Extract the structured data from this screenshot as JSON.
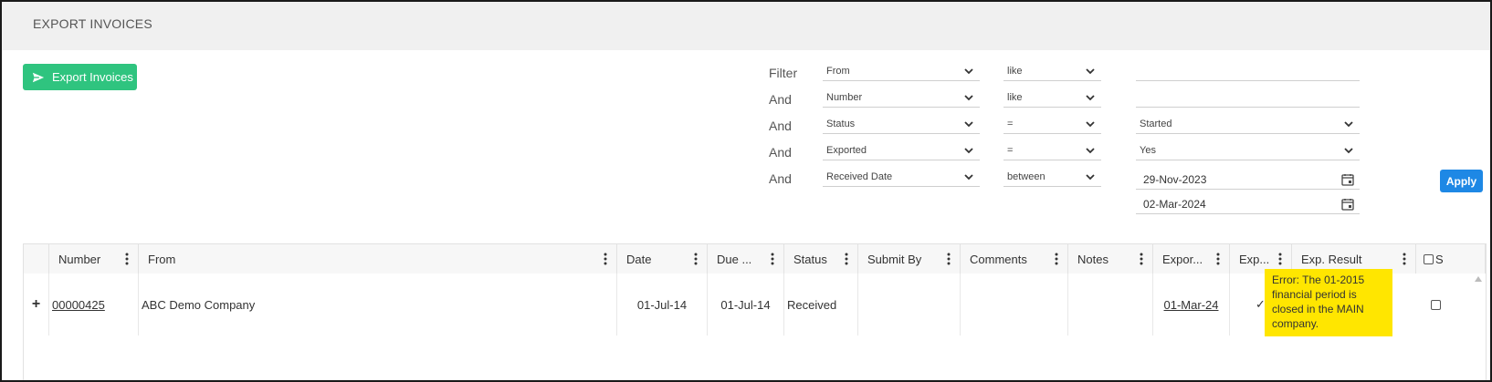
{
  "page": {
    "title": "EXPORT INVOICES"
  },
  "toolbar": {
    "export_label": "Export Invoices"
  },
  "filters": [
    {
      "keyword": "Filter",
      "field": "From",
      "operator": "like",
      "value": "",
      "value_is_select": false
    },
    {
      "keyword": "And",
      "field": "Number",
      "operator": "like",
      "value": "",
      "value_is_select": false
    },
    {
      "keyword": "And",
      "field": "Status",
      "operator": "=",
      "value": "Started",
      "value_is_select": true
    },
    {
      "keyword": "And",
      "field": "Exported",
      "operator": "=",
      "value": "Yes",
      "value_is_select": true
    },
    {
      "keyword": "And",
      "field": "Received Date",
      "operator": "between",
      "value": "29-Nov-2023",
      "value2": "02-Mar-2024",
      "value_is_select": false
    }
  ],
  "apply_label": "Apply",
  "table": {
    "columns": [
      "Number",
      "From",
      "Date",
      "Due ...",
      "Status",
      "Submit By",
      "Comments",
      "Notes",
      "Expor...",
      "Exp...",
      "Exp. Result",
      "S"
    ],
    "rows": [
      {
        "expand": "+",
        "number": "00000425",
        "from": "ABC Demo Company",
        "date": "01-Jul-14",
        "due": "01-Jul-14",
        "status": "Received",
        "submit_by": "",
        "comments": "",
        "notes": "",
        "exported_date": "01-Mar-24",
        "exported_mark": "✓",
        "exp_result": "Error: The 01-2015 financial period is closed in the MAIN company."
      }
    ]
  },
  "colors": {
    "export_button": "#2fc47f",
    "apply_button": "#1e88e5",
    "error_highlight": "#ffe600"
  }
}
